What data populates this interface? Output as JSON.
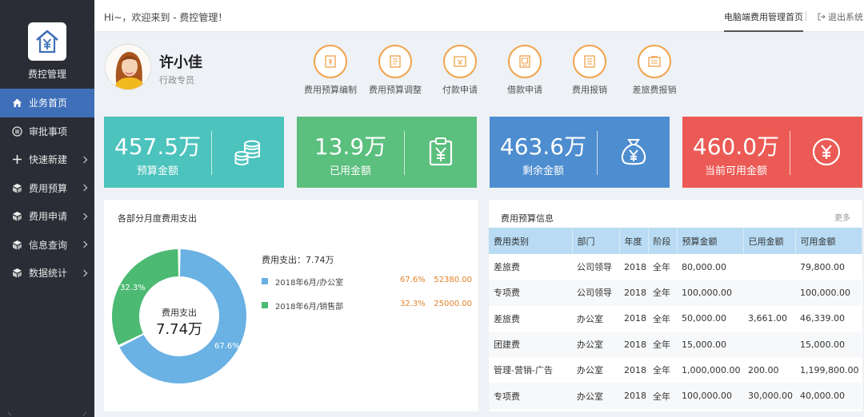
{
  "sidebar": {
    "app_title": "费控管理",
    "items": [
      {
        "label": "业务首页",
        "icon": "home-icon",
        "active": true,
        "has_arrow": false
      },
      {
        "label": "审批事项",
        "icon": "list-icon",
        "active": false,
        "has_arrow": false
      },
      {
        "label": "快速新建",
        "icon": "plus-icon",
        "active": false,
        "has_arrow": true
      },
      {
        "label": "费用预算",
        "icon": "cube-icon",
        "active": false,
        "has_arrow": true
      },
      {
        "label": "费用申请",
        "icon": "cube-icon",
        "active": false,
        "has_arrow": true
      },
      {
        "label": "信息查询",
        "icon": "cube-icon",
        "active": false,
        "has_arrow": true
      },
      {
        "label": "数据统计",
        "icon": "cube-icon",
        "active": false,
        "has_arrow": true
      }
    ]
  },
  "topbar": {
    "greeting": "Hi~，欢迎来到 - 费控管理！",
    "home_link": "电脑端费用管理首页",
    "logout": "退出系统"
  },
  "user": {
    "name": "许小佳",
    "role": "行政专员"
  },
  "shortcuts": [
    {
      "label": "费用预算编制",
      "icon": "budget-edit-icon"
    },
    {
      "label": "费用预算调整",
      "icon": "budget-adjust-icon"
    },
    {
      "label": "付款申请",
      "icon": "payment-icon"
    },
    {
      "label": "借款申请",
      "icon": "loan-icon"
    },
    {
      "label": "费用报销",
      "icon": "reimburse-icon"
    },
    {
      "label": "差旅费报销",
      "icon": "travel-reimburse-icon"
    }
  ],
  "stats": [
    {
      "value": "457.5万",
      "label": "预算金额",
      "color": "#4cc3bd",
      "icon": "coins-icon"
    },
    {
      "value": "13.9万",
      "label": "已用金额",
      "color": "#5bbf7d",
      "icon": "clipboard-yen-icon"
    },
    {
      "value": "463.6万",
      "label": "剩余金额",
      "color": "#4d8dd0",
      "icon": "money-bag-icon"
    },
    {
      "value": "460.0万",
      "label": "当前可用金额",
      "color": "#ec5a55",
      "icon": "yen-circle-icon"
    }
  ],
  "expense_panel": {
    "title": "各部分月度费用支出",
    "center_label": "费用支出",
    "center_value": "7.74万",
    "legend_title": "费用支出：7.74万",
    "slices": [
      {
        "name": "2018年6月/办公室",
        "percent": 67.6,
        "percent_label": "67.6%",
        "amount": "52380.00",
        "color": "#6ab1e4"
      },
      {
        "name": "2018年6月/销售部",
        "percent": 32.3,
        "percent_label": "32.3%",
        "amount": "25000.00",
        "color": "#4cba72"
      }
    ]
  },
  "budget_panel": {
    "title": "费用预算信息",
    "more": "更多",
    "columns": [
      "费用类别",
      "部门",
      "年度",
      "阶段",
      "预算金额",
      "已用金额",
      "可用金额"
    ],
    "rows": [
      [
        "差旅费",
        "公司领导",
        "2018",
        "全年",
        "80,000.00",
        "",
        "79,800.00"
      ],
      [
        "专项费",
        "公司领导",
        "2018",
        "全年",
        "100,000.00",
        "",
        "100,000.00"
      ],
      [
        "差旅费",
        "办公室",
        "2018",
        "全年",
        "50,000.00",
        "3,661.00",
        "46,339.00"
      ],
      [
        "团建费",
        "办公室",
        "2018",
        "全年",
        "15,000.00",
        "",
        "15,000.00"
      ],
      [
        "管理-营销-广告",
        "办公室",
        "2018",
        "全年",
        "1,000,000.00",
        "200.00",
        "1,199,800.00"
      ],
      [
        "专项费",
        "办公室",
        "2018",
        "全年",
        "100,000.00",
        "30,000.00",
        "40,000.00"
      ]
    ]
  }
}
